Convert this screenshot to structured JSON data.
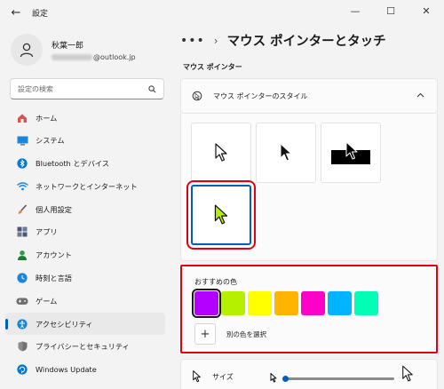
{
  "window": {
    "title": "設定",
    "back_glyph": "←",
    "minimize": "—",
    "maximize": "☐",
    "close": "✕"
  },
  "user": {
    "name": "秋葉一郎",
    "email_suffix": "@outlook.jp"
  },
  "search": {
    "placeholder": "設定の検索",
    "icon": "search-icon"
  },
  "sidebar": {
    "items": [
      {
        "label": "ホーム",
        "icon": "home-icon",
        "color": "#d9534f"
      },
      {
        "label": "システム",
        "icon": "system-icon",
        "color": "#0078d4"
      },
      {
        "label": "Bluetooth とデバイス",
        "icon": "bluetooth-icon",
        "color": "#0078d4"
      },
      {
        "label": "ネットワークとインターネット",
        "icon": "network-icon",
        "color": "#1a86d9"
      },
      {
        "label": "個人用設定",
        "icon": "brush-icon",
        "color": "#e8883a"
      },
      {
        "label": "アプリ",
        "icon": "apps-icon",
        "color": "#4a5a75"
      },
      {
        "label": "アカウント",
        "icon": "account-icon",
        "color": "#2ea043"
      },
      {
        "label": "時刻と言語",
        "icon": "time-language-icon",
        "color": "#1a86d9"
      },
      {
        "label": "ゲーム",
        "icon": "game-icon",
        "color": "#707070"
      },
      {
        "label": "アクセシビリティ",
        "icon": "accessibility-icon",
        "color": "#1a86d9",
        "active": true
      },
      {
        "label": "プライバシーとセキュリティ",
        "icon": "shield-icon",
        "color": "#707070"
      },
      {
        "label": "Windows Update",
        "icon": "update-icon",
        "color": "#0078d4"
      }
    ]
  },
  "main": {
    "breadcrumb_more": "•••",
    "breadcrumb_sep": "›",
    "title": "マウス ポインターとタッチ",
    "section": "マウス ポインター",
    "pointer_style": {
      "label": "マウス ポインターのスタイル",
      "expanded": true
    },
    "styles": [
      {
        "name": "white",
        "selected": false
      },
      {
        "name": "black",
        "selected": false
      },
      {
        "name": "inverted",
        "selected": false
      },
      {
        "name": "custom",
        "selected": true,
        "color": "#b4f000"
      }
    ],
    "recommended_colors": {
      "label": "おすすめの色",
      "colors": [
        "#b400ff",
        "#b4f000",
        "#ffff00",
        "#ffb400",
        "#ff00c8",
        "#00b4ff",
        "#00ffb4"
      ],
      "selected_index": 0,
      "custom_label": "別の色を選択",
      "plus": "+"
    },
    "size": {
      "label": "サイズ",
      "value": 1
    }
  }
}
